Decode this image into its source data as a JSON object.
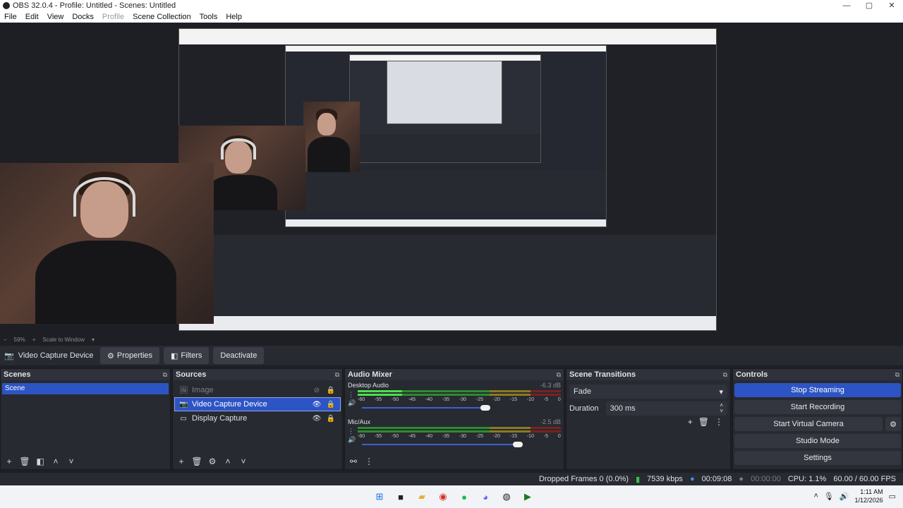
{
  "window": {
    "title": "OBS 32.0.4 - Profile: Untitled - Scenes: Untitled",
    "controls": [
      "—",
      "▢",
      "✕"
    ]
  },
  "menu": [
    "File",
    "Edit",
    "View",
    "Docks",
    "Profile",
    "Scene Collection",
    "Tools",
    "Help"
  ],
  "zoom": {
    "minus": "−",
    "level": "59%",
    "plus": "+",
    "mode": "Scale to Window"
  },
  "source_toolbar": {
    "device": "Video Capture Device",
    "properties": "Properties",
    "filters": "Filters",
    "deactivate": "Deactivate"
  },
  "scenes": {
    "title": "Scenes",
    "items": [
      "Scene"
    ]
  },
  "sources": {
    "title": "Sources",
    "items": [
      {
        "label": "Image",
        "icon": "image-icon"
      },
      {
        "label": "Video Capture Device",
        "icon": "camera-icon"
      },
      {
        "label": "Display Capture",
        "icon": "monitor-icon"
      }
    ]
  },
  "mixer": {
    "title": "Audio Mixer",
    "channels": [
      {
        "name": "Desktop Audio",
        "db": "-6.3 dB",
        "level": 0.22,
        "fader": 0.73
      },
      {
        "name": "Mic/Aux",
        "db": "-2.5 dB",
        "level": 0.0,
        "fader": 0.92
      }
    ],
    "ticks": [
      "-60",
      "-55",
      "-50",
      "-45",
      "-40",
      "-35",
      "-30",
      "-25",
      "-20",
      "-15",
      "-10",
      "-5",
      "0"
    ]
  },
  "transitions": {
    "title": "Scene Transitions",
    "selected": "Fade",
    "duration_label": "Duration",
    "duration": "300 ms"
  },
  "controls": {
    "title": "Controls",
    "stop_streaming": "Stop Streaming",
    "start_recording": "Start Recording",
    "start_virtual_camera": "Start Virtual Camera",
    "studio_mode": "Studio Mode",
    "settings": "Settings"
  },
  "status": {
    "dropped": "Dropped Frames 0 (0.0%)",
    "bitrate": "7539 kbps",
    "stream_time": "00:09:08",
    "rec_time": "00:00:00",
    "cpu": "CPU: 1.1%",
    "fps": "60.00 / 60.00 FPS"
  },
  "taskbar": {
    "time": "1:11 AM",
    "date": "1/12/2026"
  },
  "colors": {
    "accent": "#2d54c4",
    "panel": "#272a30",
    "background": "#1e1f24"
  }
}
